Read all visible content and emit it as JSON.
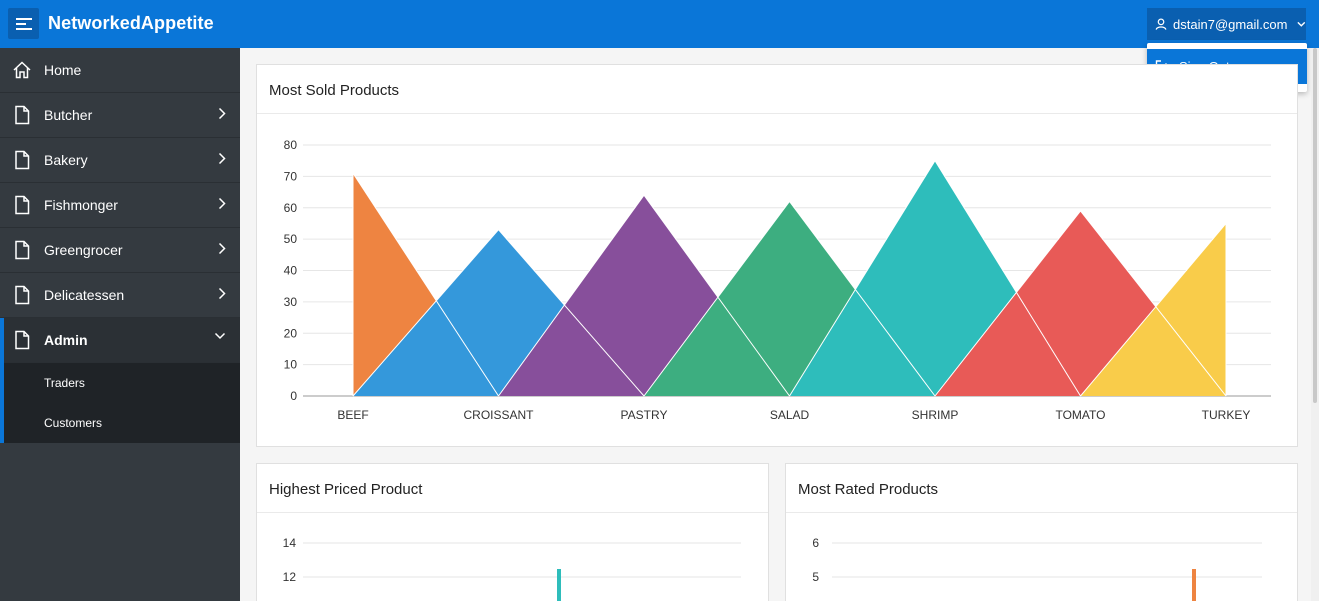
{
  "header": {
    "brand": "NetworkedAppetite",
    "user_email": "dstain7@gmail.com",
    "dropdown": {
      "sign_out": "Sign Out"
    }
  },
  "sidebar": {
    "items": [
      {
        "label": "Home",
        "icon": "home-icon"
      },
      {
        "label": "Butcher",
        "icon": "page-icon"
      },
      {
        "label": "Bakery",
        "icon": "page-icon"
      },
      {
        "label": "Fishmonger",
        "icon": "page-icon"
      },
      {
        "label": "Greengrocer",
        "icon": "page-icon"
      },
      {
        "label": "Delicatessen",
        "icon": "page-icon"
      },
      {
        "label": "Admin",
        "icon": "page-icon"
      }
    ],
    "admin_sub": [
      {
        "label": "Traders"
      },
      {
        "label": "Customers"
      }
    ]
  },
  "colors": {
    "header": "#0a76d8",
    "sidebar": "#343a40",
    "beef": "#ee8441",
    "croissant": "#3498db",
    "pastry": "#874f9b",
    "salad": "#3dae80",
    "shrimp": "#2ebdbb",
    "tomato": "#e85a57",
    "turkey": "#f9cc4a"
  },
  "cards": {
    "most_sold": "Most Sold Products",
    "highest_priced": "Highest Priced Product",
    "most_rated": "Most Rated Products"
  },
  "chart_data": [
    {
      "type": "area",
      "title": "Most Sold Products",
      "categories": [
        "BEEF",
        "CROISSANT",
        "PASTRY",
        "SALAD",
        "SHRIMP",
        "TOMATO",
        "TURKEY"
      ],
      "values": [
        71,
        53,
        64,
        62,
        75,
        59,
        55
      ],
      "ylim": [
        0,
        80
      ],
      "yticks": [
        0,
        10,
        20,
        30,
        40,
        50,
        60,
        70,
        80
      ],
      "grid": true
    },
    {
      "type": "bar",
      "title": "Highest Priced Product",
      "yticks": [
        12,
        14
      ],
      "grid": true
    },
    {
      "type": "bar",
      "title": "Most Rated Products",
      "yticks": [
        5,
        6
      ],
      "grid": true
    }
  ]
}
